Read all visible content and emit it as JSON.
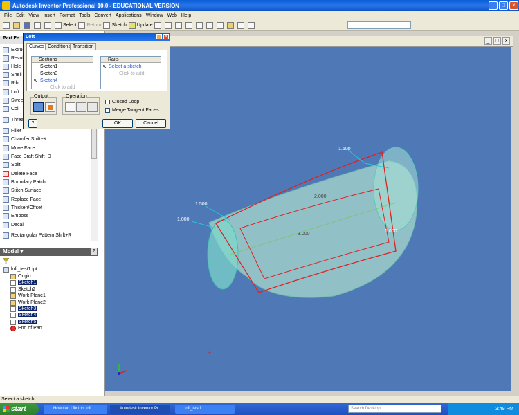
{
  "window": {
    "title": "Autodesk Inventor Professional 10.0 - EDUCATIONAL VERSION"
  },
  "menubar": [
    "File",
    "Edit",
    "View",
    "Insert",
    "Format",
    "Tools",
    "Convert",
    "Applications",
    "Window",
    "Web",
    "Help"
  ],
  "toolbar": {
    "select_label": "Select",
    "return_label": "Return",
    "sketch_label": "Sketch",
    "update_label": "Update"
  },
  "left_panel": {
    "header": "Part Fe",
    "features": [
      {
        "label": "Extrude"
      },
      {
        "label": "Revolve"
      },
      {
        "label": "Hole"
      },
      {
        "label": "Shell"
      },
      {
        "label": "Rib"
      },
      {
        "label": "Loft"
      },
      {
        "label": "Sweep"
      },
      {
        "label": "Coil"
      },
      {
        "label": "Thread"
      },
      {
        "label": "Fillet"
      },
      {
        "label": "Chamfer  Shift+K"
      },
      {
        "label": "Move Face"
      },
      {
        "label": "Face Draft  Shift+D"
      },
      {
        "label": "Split"
      },
      {
        "label": "Delete Face"
      },
      {
        "label": "Boundary Patch"
      },
      {
        "label": "Stitch Surface"
      },
      {
        "label": "Replace Face"
      },
      {
        "label": "Thicken/Offset"
      },
      {
        "label": "Emboss"
      },
      {
        "label": "Decal"
      },
      {
        "label": "Rectangular Pattern  Shift+R"
      }
    ]
  },
  "model_panel": {
    "header": "Model ▾",
    "help": "?",
    "tree": [
      {
        "label": "loft_test1.ipt",
        "selected": false
      },
      {
        "label": "Origin",
        "selected": false
      },
      {
        "label": "Sketch1",
        "selected": true
      },
      {
        "label": "Sketch2",
        "selected": false
      },
      {
        "label": "Work Plane1",
        "selected": false
      },
      {
        "label": "Work Plane2",
        "selected": false
      },
      {
        "label": "Sketch3",
        "selected": true
      },
      {
        "label": "Sketch4",
        "selected": true
      },
      {
        "label": "Sketch5",
        "selected": true
      },
      {
        "label": "End of Part",
        "selected": false
      }
    ]
  },
  "dialog": {
    "title": "Loft",
    "tabs": [
      "Curves",
      "Conditions",
      "Transition"
    ],
    "sections_header": "Sections",
    "sections": [
      "Sketch1",
      "Sketch3",
      "Sketch4"
    ],
    "sections_add": "Click to add",
    "rails_header": "Rails",
    "rails_prompt": "Select a sketch",
    "rails_add": "Click to add",
    "output_label": "Output",
    "operation_label": "Operation",
    "closed_loop": "Closed Loop",
    "merge_tangent": "Merge Tangent Faces",
    "help": "?",
    "ok": "OK",
    "cancel": "Cancel"
  },
  "viewport": {
    "dimensions": [
      "1.500",
      "1.500",
      "1.000",
      "2.000",
      "1.000",
      "3.000"
    ]
  },
  "status": "Select a sketch",
  "taskbar": {
    "start": "start",
    "tasks": [
      "How can I fix this loft....",
      "Autodesk Inventor Pr...",
      "loft_test1"
    ],
    "search": "Search Desktop",
    "clock": "3:49 PM"
  },
  "colors": {
    "viewport_bg": "#4f79b6",
    "model_fill": "#a8d8cc",
    "sketch_red": "#d22",
    "dimension_cyan": "#1cc8e0"
  }
}
